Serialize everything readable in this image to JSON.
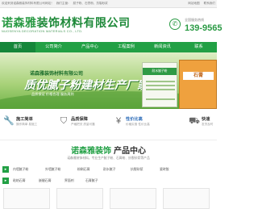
{
  "topbar": {
    "left": [
      "欢迎来到诺森雅装饰材料有限公司网站！",
      "我们主营：",
      "腻子粉、石膏粉、抗裂砂浆"
    ],
    "right": [
      "网站地图",
      "联系我们"
    ]
  },
  "header": {
    "logo_prefix": "诺森雅",
    "logo_rest": "装饰材料有限公司",
    "logo_en": "NUOSENYA DECORATION MATERIALS CO., LTD.",
    "phone_label": "全国服务热线",
    "phone_number": "139-9565"
  },
  "nav": {
    "items": [
      "首页",
      "公司简介",
      "产品中心",
      "工程案例",
      "新闻资讯",
      "联系"
    ],
    "active_index": 0
  },
  "banner": {
    "line1": "诺森雅装饰材料有限公司",
    "line2": "质优腻子粉建材生产厂家",
    "line3": "品质保证  价格合理  服务周到",
    "bag1_label": "耐水腻子粉",
    "bag2_label": "石膏"
  },
  "features": [
    {
      "title": "施工简单",
      "sub": "操作简单 易施工",
      "icon": "wrench-icon"
    },
    {
      "title": "品质保障",
      "sub": "严格把关 质量可靠",
      "icon": "shield-icon"
    },
    {
      "title": "性价比高",
      "sub": "价格实惠 性价比高",
      "icon": "coin-icon"
    },
    {
      "title": "快速",
      "sub": "发货及时",
      "icon": "truck-icon"
    }
  ],
  "products": {
    "title_green": "诺森雅装饰",
    "title_dark": "产品中心",
    "subtitle": "诺森雅装饰材料，专业生产腻子粉、石膏粉、抗裂砂浆等产品",
    "row1": [
      "内墙腻子粉",
      "外墙腻子粉",
      "粉刷石膏",
      "耐水腻子",
      "抗裂砂浆",
      "瓷砖胶"
    ],
    "row2": [
      "粘结石膏",
      "嵌缝石膏",
      "界面剂",
      "石膏腻子"
    ]
  },
  "colors": {
    "brand": "#22a045",
    "brand_dark": "#15863a"
  }
}
